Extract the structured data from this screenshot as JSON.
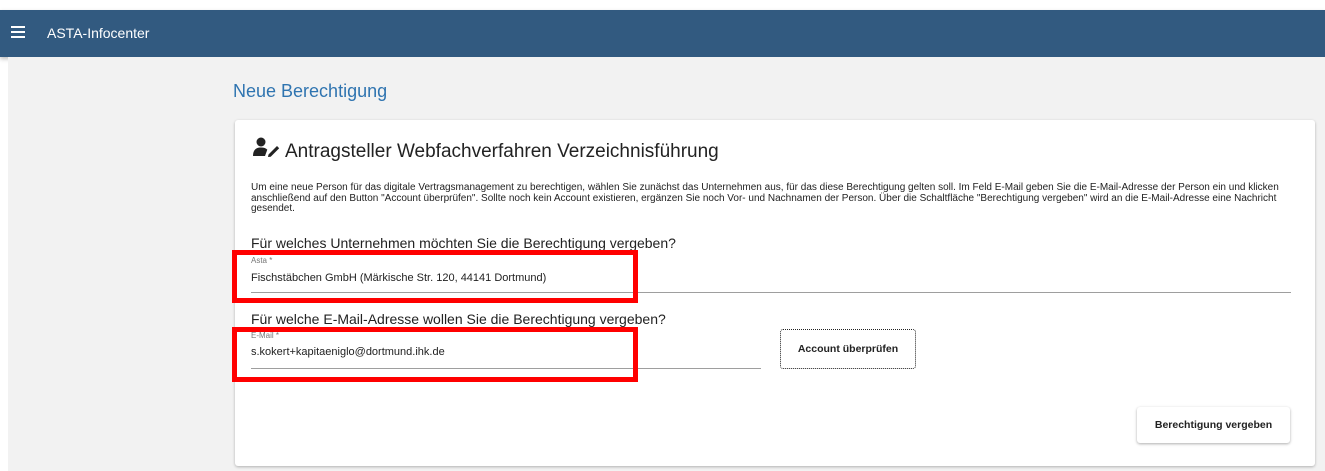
{
  "app": {
    "title": "ASTA-Infocenter"
  },
  "colors": {
    "appbar": "#325a80",
    "page_title": "#2f74b0",
    "highlight": "#ff0000"
  },
  "icons": {
    "menu": "hamburger-menu-icon",
    "card": "user-edit-icon"
  },
  "page": {
    "title": "Neue Berechtigung"
  },
  "card": {
    "heading": "Antragsteller Webfachverfahren Verzeichnisführung",
    "description": "Um eine neue Person für das digitale Vertragsmanagement zu berechtigen, wählen Sie zunächst das Unternehmen aus, für das diese Berechtigung gelten soll. Im Feld E-Mail geben Sie die E-Mail-Adresse der Person ein und klicken anschließend auf den Button \"Account überprüfen\". Sollte noch kein Account existieren, ergänzen Sie noch Vor- und Nachnamen der Person. Über die Schaltfläche \"Berechtigung vergeben\" wird an die E-Mail-Adresse eine Nachricht gesendet.",
    "company_question": "Für welches Unternehmen möchten Sie die Berechtigung vergeben?",
    "company_field": {
      "label": "Asta *",
      "value": "Fischstäbchen GmbH (Märkische Str. 120, 44141 Dortmund)"
    },
    "email_question": "Für welche E-Mail-Adresse wollen Sie die Berechtigung vergeben?",
    "email_field": {
      "label": "E-Mail *",
      "value": "s.kokert+kapitaeniglo@dortmund.ihk.de"
    },
    "check_account_label": "Account überprüfen",
    "grant_label": "Berechtigung vergeben"
  }
}
